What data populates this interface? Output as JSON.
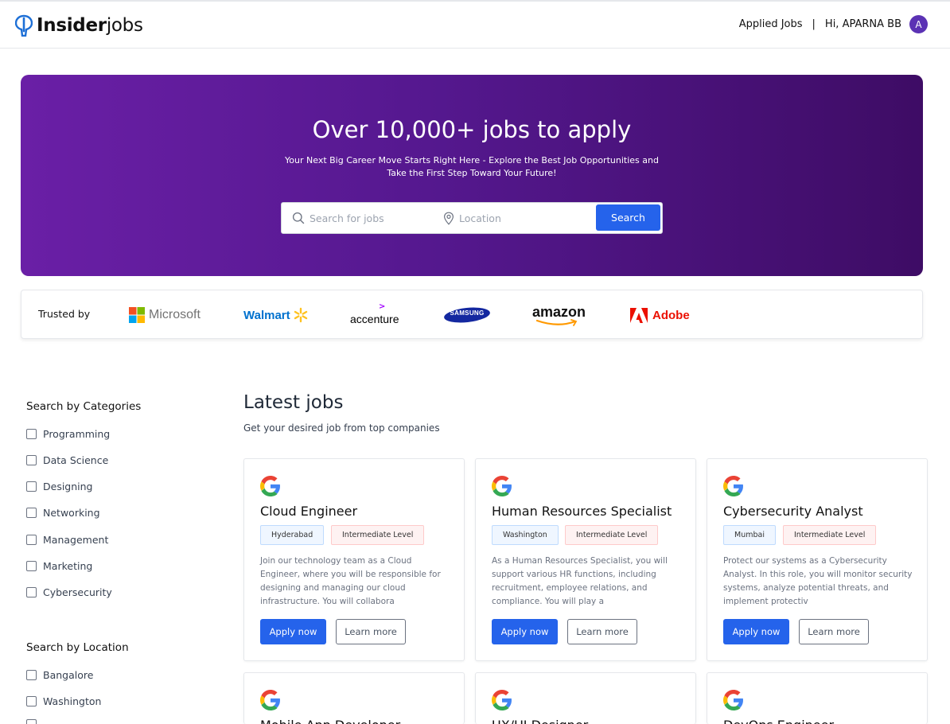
{
  "navbar": {
    "logo_bold": "Insider",
    "logo_light": "jobs",
    "applied_jobs": "Applied Jobs",
    "separator": "|",
    "greeting": "Hi, APARNA BB",
    "avatar_initial": "A"
  },
  "hero": {
    "title": "Over 10,000+ jobs to apply",
    "subtitle_line1": "Your Next Big Career Move Starts Right Here - Explore the Best Job Opportunities and",
    "subtitle_line2": "Take the First Step Toward Your Future!",
    "search_placeholder": "Search for jobs",
    "location_placeholder": "Location",
    "search_button": "Search"
  },
  "trusted": {
    "label": "Trusted by",
    "brands": [
      "Microsoft",
      "Walmart",
      "accenture",
      "SAMSUNG",
      "amazon",
      "Adobe"
    ]
  },
  "sidebar": {
    "categories_title": "Search by Categories",
    "categories": [
      "Programming",
      "Data Science",
      "Designing",
      "Networking",
      "Management",
      "Marketing",
      "Cybersecurity"
    ],
    "location_title": "Search by Location",
    "locations": [
      "Bangalore",
      "Washington"
    ]
  },
  "jobs": {
    "title": "Latest jobs",
    "subtitle": "Get your desired job from top companies",
    "apply_label": "Apply now",
    "learn_label": "Learn more",
    "items": [
      {
        "title": "Cloud Engineer",
        "location": "Hyderabad",
        "level": "Intermediate Level",
        "description": "Join our technology team as a Cloud Engineer, where you will be responsible for designing and managing our cloud infrastructure. You will collabora"
      },
      {
        "title": "Human Resources Specialist",
        "location": "Washington",
        "level": "Intermediate Level",
        "description": "As a Human Resources Specialist, you will support various HR functions, including recruitment, employee relations, and compliance. You will play a"
      },
      {
        "title": "Cybersecurity Analyst",
        "location": "Mumbai",
        "level": "Intermediate Level",
        "description": "Protect our systems as a Cybersecurity Analyst. In this role, you will monitor security systems, analyze potential threats, and implement protectiv"
      },
      {
        "title": "Mobile App Developer"
      },
      {
        "title": "UX/UI Designer"
      },
      {
        "title": "DevOps Engineer"
      }
    ]
  },
  "colors": {
    "primary": "#2563eb",
    "hero_start": "#6a1fa6",
    "hero_end": "#3e0c65",
    "avatar": "#5b32b4"
  }
}
